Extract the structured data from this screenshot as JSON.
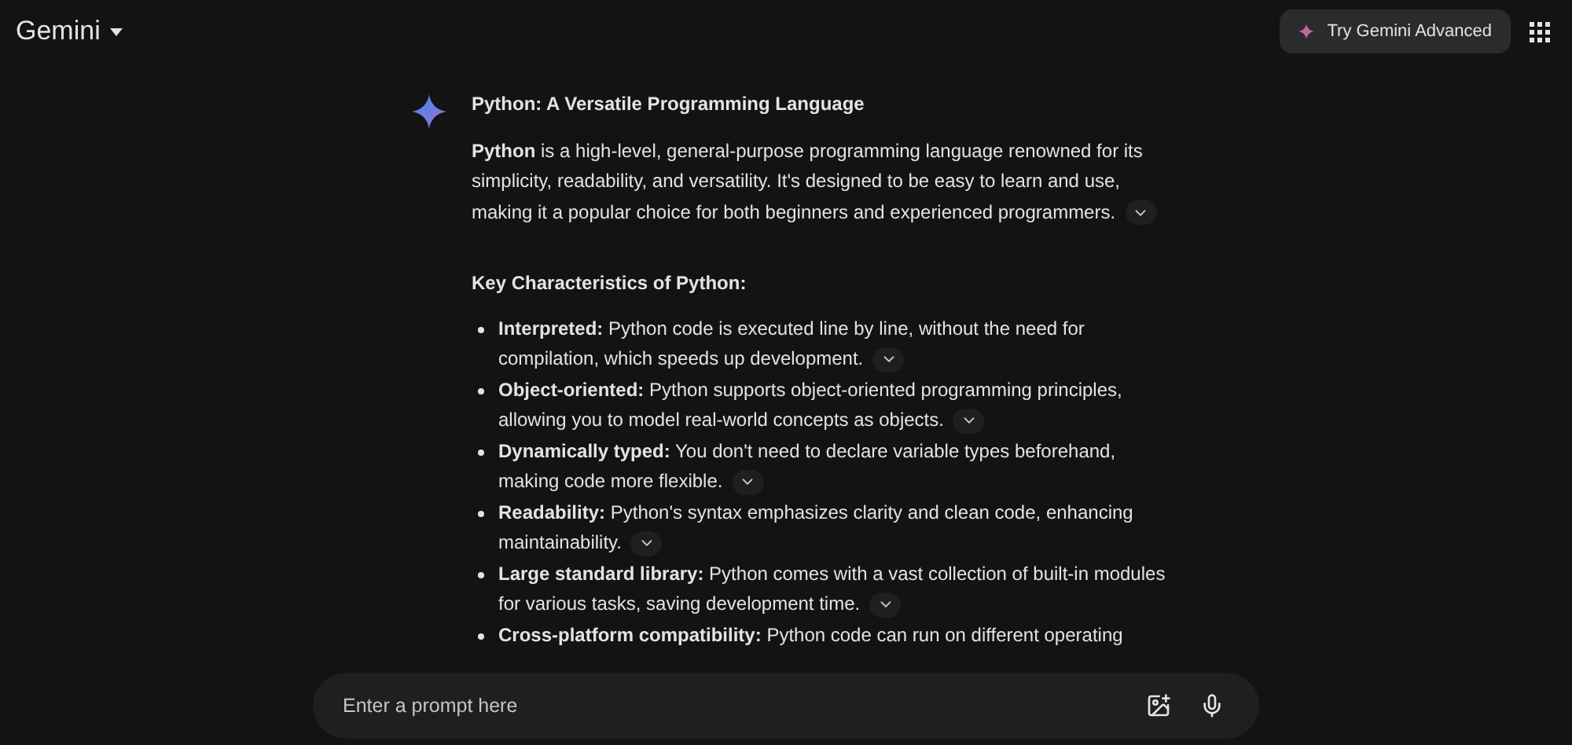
{
  "header": {
    "title": "Gemini",
    "upgrade_button": "Try Gemini Advanced"
  },
  "response": {
    "title": "Python: A Versatile Programming Language",
    "intro": {
      "text": "**Python** is a high-level, general-purpose programming language renowned for its simplicity, readability, and versatility. It's designed to be easy to learn and use, making it a popular choice for both beginners and experienced programmers.",
      "source_chip": true
    },
    "section_heading": "Key Characteristics of Python:",
    "bullets": [
      {
        "text": "**Interpreted:** Python code is executed line by line, without the need for compilation, which speeds up development.",
        "source_chip": true
      },
      {
        "text": "**Object-oriented:** Python supports object-oriented programming principles, allowing you to model real-world concepts as objects.",
        "source_chip": true
      },
      {
        "text": "**Dynamically typed:** You don't need to declare variable types beforehand, making code more flexible.",
        "source_chip": true
      },
      {
        "text": "**Readability:** Python's syntax emphasizes clarity and clean code, enhancing maintainability.",
        "source_chip": true
      },
      {
        "text": "**Large standard library:** Python comes with a vast collection of built-in modules for various tasks, saving development time.",
        "source_chip": true
      },
      {
        "text": "**Cross-platform compatibility:** Python code can run on different operating",
        "source_chip": false
      }
    ]
  },
  "prompt": {
    "placeholder": "Enter a prompt here"
  }
}
